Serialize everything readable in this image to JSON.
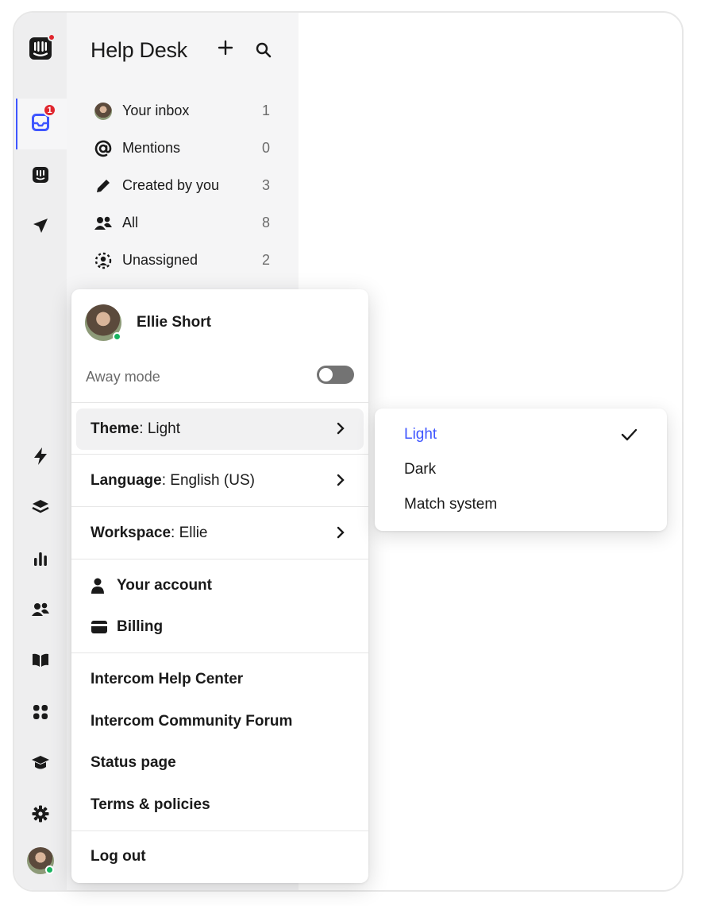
{
  "panel": {
    "title": "Help Desk"
  },
  "nav": [
    {
      "label": "Your inbox",
      "count": "1",
      "icon": "avatar-icon"
    },
    {
      "label": "Mentions",
      "count": "0",
      "icon": "at-icon"
    },
    {
      "label": "Created by you",
      "count": "3",
      "icon": "pencil-icon"
    },
    {
      "label": "All",
      "count": "8",
      "icon": "people-icon"
    },
    {
      "label": "Unassigned",
      "count": "2",
      "icon": "unassigned-icon"
    }
  ],
  "rail": {
    "inbox_badge": "1"
  },
  "menu": {
    "user_name": "Ellie Short",
    "away_label": "Away mode",
    "away_enabled": false,
    "theme_key": "Theme",
    "theme_value": "Light",
    "language_key": "Language",
    "language_value": "English (US)",
    "workspace_key": "Workspace",
    "workspace_value": "Ellie",
    "your_account": "Your account",
    "billing": "Billing",
    "help_center": "Intercom Help Center",
    "community": "Intercom Community Forum",
    "status_page": "Status page",
    "terms": "Terms & policies",
    "logout": "Log out"
  },
  "theme_submenu": {
    "options": [
      "Light",
      "Dark",
      "Match system"
    ],
    "selected": "Light"
  },
  "colors": {
    "accent": "#3f56ff",
    "badge": "#e0262e",
    "online": "#19b360"
  }
}
